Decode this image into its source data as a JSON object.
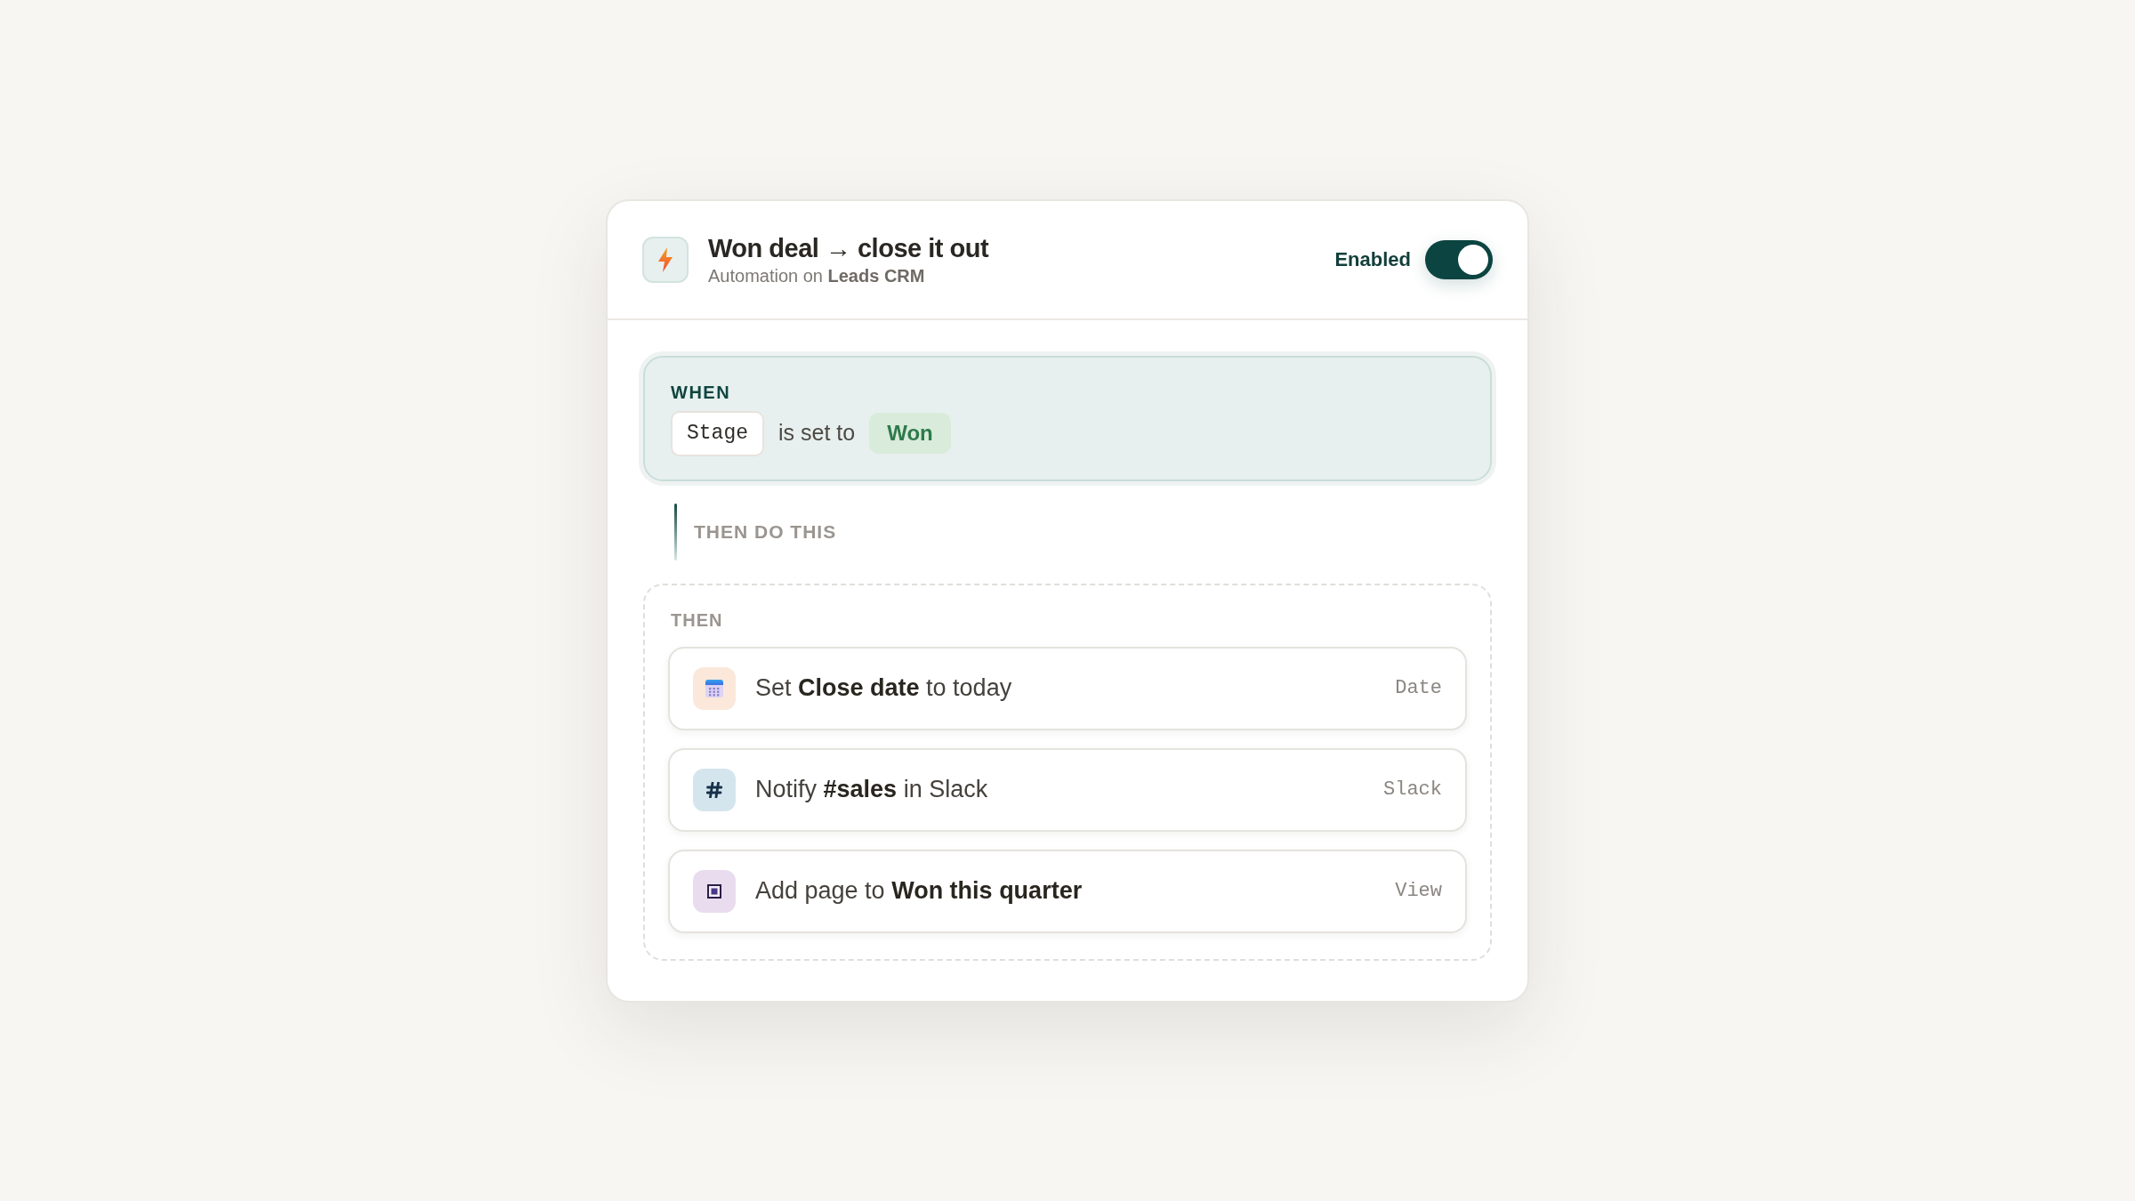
{
  "header": {
    "title": "Won deal → close it out",
    "subtitle": "Automation on **Leads CRM**",
    "toggle": {
      "label": "Enabled",
      "on": true
    }
  },
  "trigger": {
    "heading": "WHEN",
    "field": "Stage",
    "operator": "is set to",
    "value": "Won"
  },
  "connector": {
    "label": "THEN DO THIS"
  },
  "actions": {
    "heading": "THEN",
    "items": [
      {
        "kind": "calendar",
        "text": "Set **Close date** to today",
        "tag": "Date"
      },
      {
        "kind": "hash",
        "text": "Notify **#sales** in Slack",
        "tag": "Slack"
      },
      {
        "kind": "view",
        "text": "Add page to **Won this quarter**",
        "tag": "View"
      }
    ]
  }
}
